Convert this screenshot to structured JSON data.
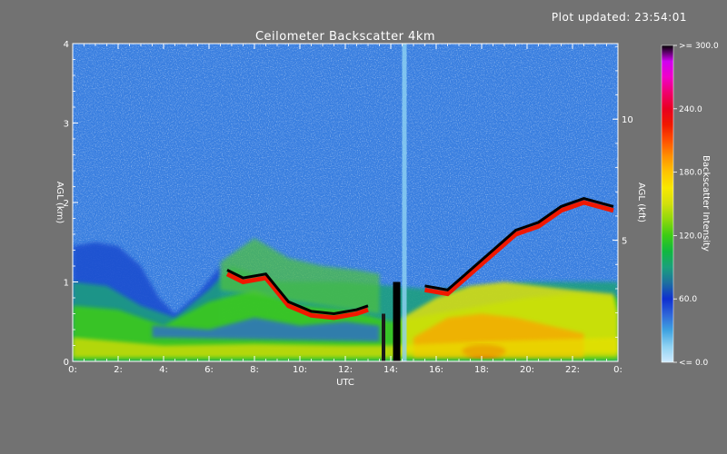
{
  "plot_updated": "Plot updated: 23:54:01",
  "chart_data": {
    "type": "heatmap",
    "title": "Ceilometer Backscatter 4km",
    "xlabel": "UTC",
    "ylabel_left": "AGL (km)",
    "ylabel_right": "AGL (kft)",
    "xlim": [
      0,
      24
    ],
    "ylim": [
      0,
      4
    ],
    "ylim_right_kft": [
      0,
      13.12
    ],
    "x_ticks": [
      0,
      2,
      4,
      6,
      8,
      10,
      12,
      14,
      16,
      18,
      20,
      22,
      24
    ],
    "x_tick_labels": [
      "0:",
      "2:",
      "4:",
      "6:",
      "8:",
      "10:",
      "12:",
      "14:",
      "16:",
      "18:",
      "20:",
      "22:",
      "0:"
    ],
    "y_ticks_left": [
      0,
      1,
      2,
      3,
      4
    ],
    "y_tick_labels_left": [
      "0",
      "1",
      "2",
      "3",
      "4"
    ],
    "y_ticks_right_kft": [
      5,
      10
    ],
    "y_tick_labels_right": [
      "5",
      "10"
    ],
    "colorbar": {
      "label": "Backscatter Intensity",
      "range": [
        0,
        300
      ],
      "ticks": [
        0,
        60,
        120,
        180,
        240,
        300
      ],
      "tick_labels": [
        "<=   0.0",
        "60.0",
        "120.0",
        "180.0",
        "240.0",
        ">= 300.0"
      ],
      "colors": [
        "#cfeaff",
        "#8fd2f2",
        "#3fa3e0",
        "#2f66d8",
        "#0f2fd0",
        "#1e6fa0",
        "#1aa07c",
        "#10b840",
        "#3ccc14",
        "#8ed80c",
        "#d2e00c",
        "#f8e800",
        "#ffc400",
        "#ff9000",
        "#ff5000",
        "#f01800",
        "#e80020",
        "#f0006c",
        "#f000c8",
        "#d000f0",
        "#000000"
      ]
    },
    "features": [
      {
        "name": "surface layer",
        "x_start": 0,
        "x_end": 24,
        "y_top_km": 0.3
      },
      {
        "name": "residual layer top",
        "x_start": 6.5,
        "x_end": 14,
        "y_top_km": 1.2
      },
      {
        "name": "cloud base",
        "x_start": 6.8,
        "x_end": 13,
        "y_km": 0.6
      },
      {
        "name": "cloud base",
        "x_start": 15.5,
        "x_end": 23.8,
        "y_km": 1.5
      },
      {
        "name": "precipitation column",
        "x_start": 13.5,
        "x_end": 14.3,
        "y_km": 0
      }
    ]
  }
}
